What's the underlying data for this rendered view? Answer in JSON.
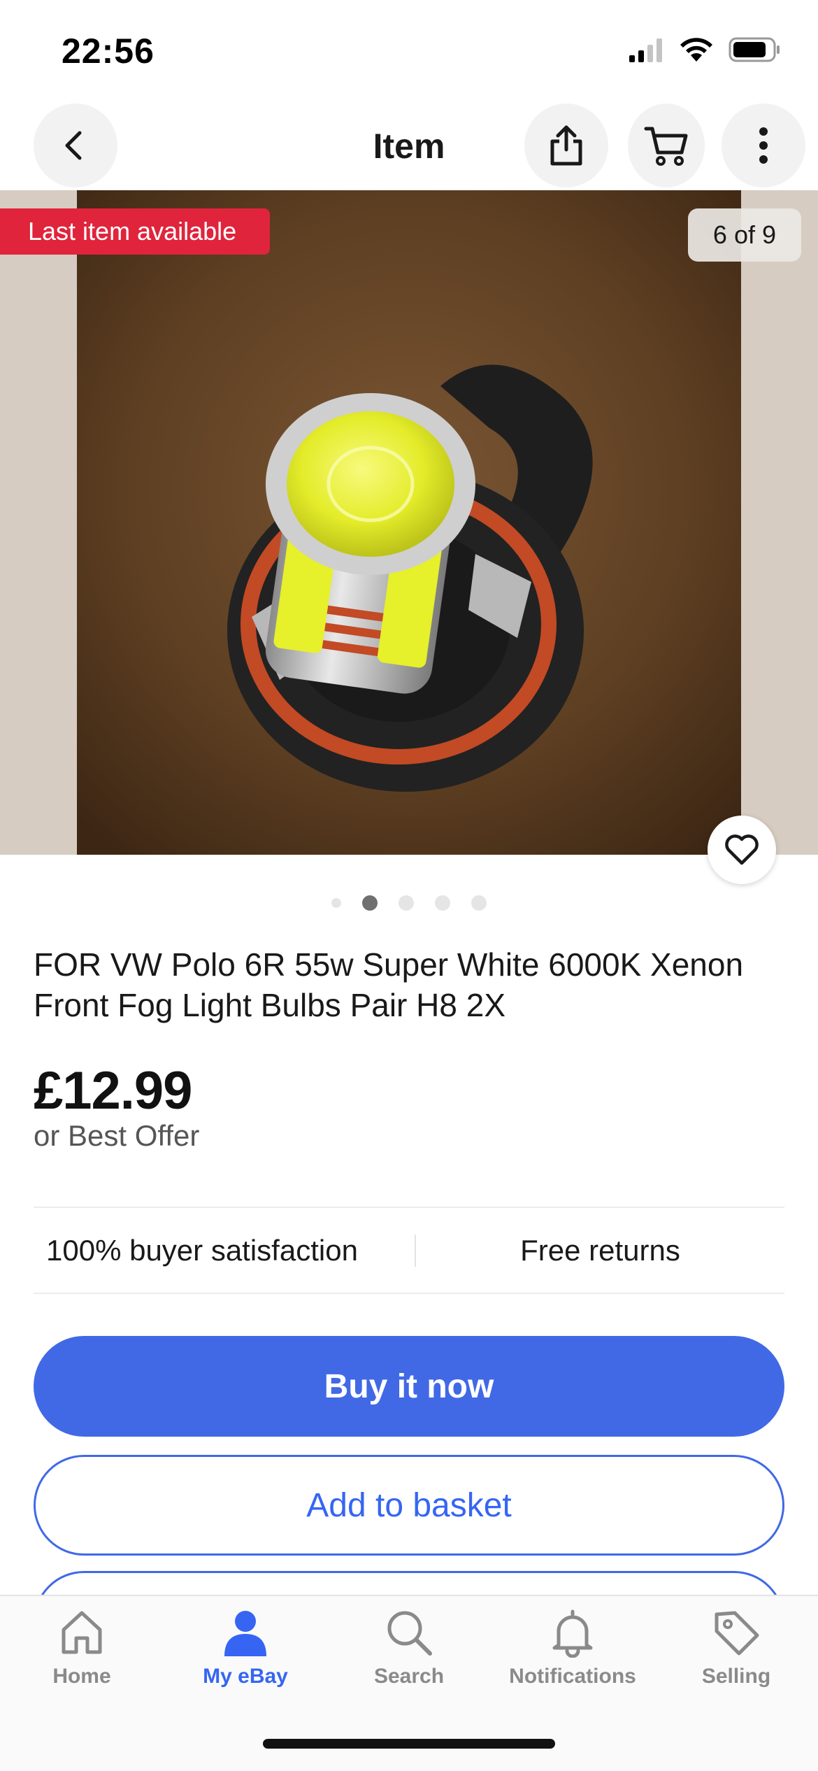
{
  "status_bar": {
    "time": "22:56"
  },
  "header": {
    "title": "Item"
  },
  "gallery": {
    "badge": "Last item available",
    "counter": "6 of 9"
  },
  "listing": {
    "title": "FOR VW Polo 6R 55w Super White 6000K Xenon  Front Fog Light Bulbs Pair H8 2X",
    "price": "£12.99",
    "offer_text": "or Best Offer",
    "features": [
      "100% buyer satisfaction",
      "Free returns"
    ]
  },
  "actions": {
    "buy_now": "Buy it now",
    "add_to_basket": "Add to basket"
  },
  "tabbar": {
    "items": [
      {
        "label": "Home",
        "icon": "home-icon",
        "active": false
      },
      {
        "label": "My eBay",
        "icon": "person-icon",
        "active": true
      },
      {
        "label": "Search",
        "icon": "search-icon",
        "active": false
      },
      {
        "label": "Notifications",
        "icon": "bell-icon",
        "active": false
      },
      {
        "label": "Selling",
        "icon": "tag-icon",
        "active": false
      }
    ]
  },
  "colors": {
    "accent": "#3665f3",
    "badge_red": "#e0243c",
    "text": "#191919"
  }
}
